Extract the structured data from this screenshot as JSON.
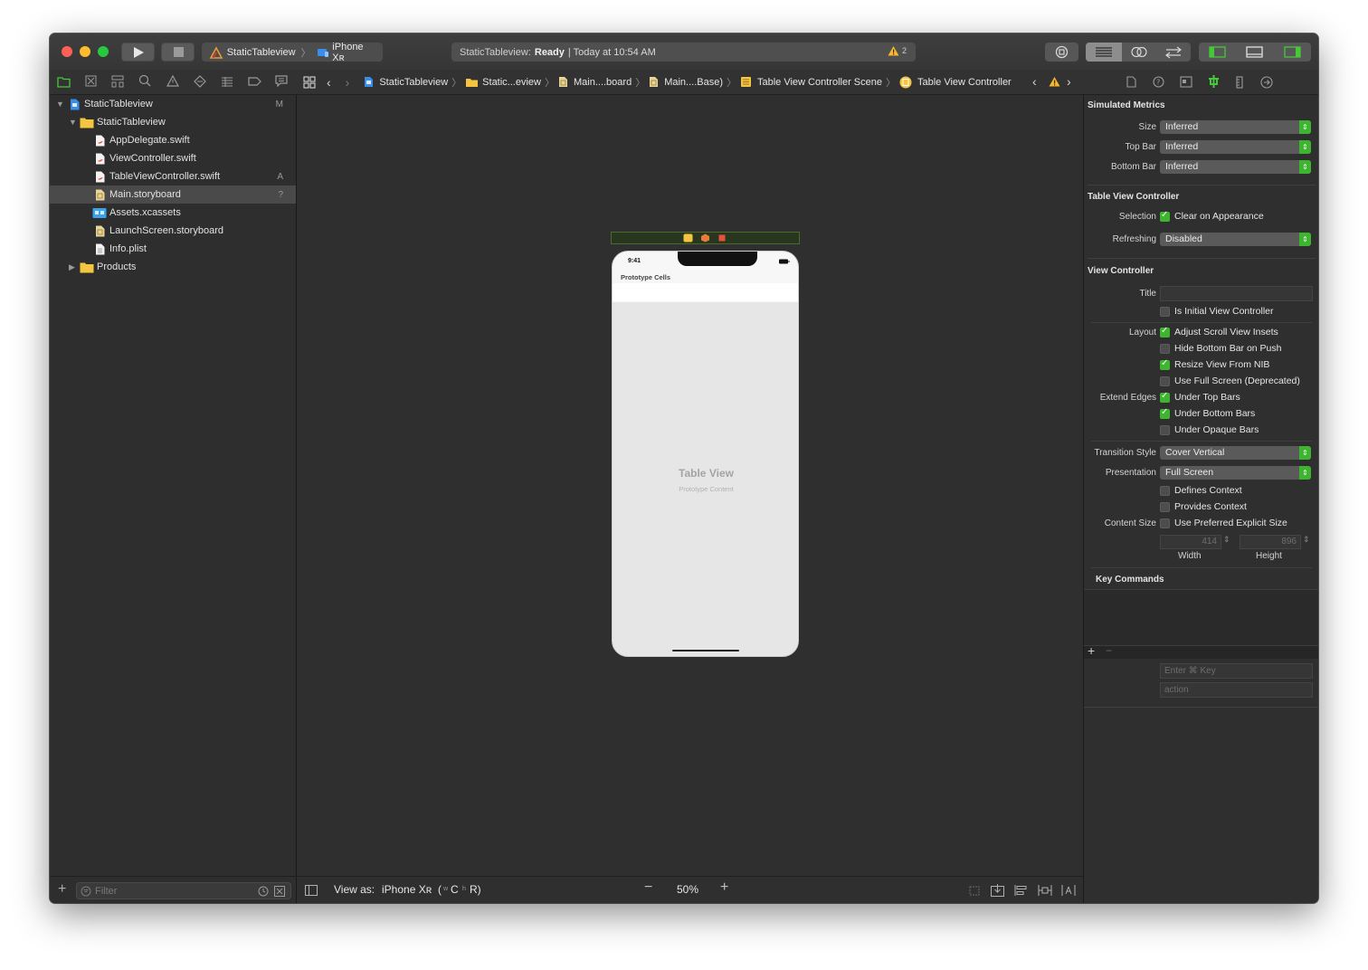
{
  "toolbar": {
    "scheme_name": "StaticTableview",
    "device_name": "iPhone Xʀ",
    "status_project": "StaticTableview:",
    "status_state": "Ready",
    "status_time": "| Today at 10:54 AM",
    "warning_count": "2"
  },
  "jumpbar": {
    "items": [
      "StaticTableview",
      "Static...eview",
      "Main....board",
      "Main....Base)",
      "Table View Controller Scene",
      "Table View Controller"
    ]
  },
  "navigator": {
    "items": [
      {
        "label": "StaticTableview",
        "badge": "M"
      },
      {
        "label": "StaticTableview",
        "badge": ""
      },
      {
        "label": "AppDelegate.swift",
        "badge": ""
      },
      {
        "label": "ViewController.swift",
        "badge": ""
      },
      {
        "label": "TableViewController.swift",
        "badge": "A"
      },
      {
        "label": "Main.storyboard",
        "badge": "?"
      },
      {
        "label": "Assets.xcassets",
        "badge": ""
      },
      {
        "label": "LaunchScreen.storyboard",
        "badge": ""
      },
      {
        "label": "Info.plist",
        "badge": ""
      },
      {
        "label": "Products",
        "badge": ""
      }
    ],
    "filter_placeholder": "Filter"
  },
  "canvas": {
    "phone_time": "9:41",
    "section_header": "Prototype Cells",
    "table_title": "Table View",
    "table_subtitle": "Prototype Content",
    "view_as_prefix": "View as:",
    "view_as_device": "iPhone Xʀ",
    "view_as_w": "w",
    "view_as_c": "C",
    "view_as_h": "h",
    "view_as_r": "R)",
    "view_as_paren": "(",
    "zoom": "50%"
  },
  "inspector": {
    "simulated_metrics": {
      "title": "Simulated Metrics",
      "size_label": "Size",
      "size_value": "Inferred",
      "topbar_label": "Top Bar",
      "topbar_value": "Inferred",
      "bottombar_label": "Bottom Bar",
      "bottombar_value": "Inferred"
    },
    "table_view_controller": {
      "title": "Table View Controller",
      "selection_label": "Selection",
      "clear_on_appearance": "Clear on Appearance",
      "refreshing_label": "Refreshing",
      "refreshing_value": "Disabled"
    },
    "view_controller": {
      "title": "View Controller",
      "title_label": "Title",
      "is_initial": "Is Initial View Controller",
      "layout_label": "Layout",
      "adjust_scroll": "Adjust Scroll View Insets",
      "hide_bottom_bar": "Hide Bottom Bar on Push",
      "resize_view": "Resize View From NIB",
      "use_full_screen": "Use Full Screen (Deprecated)",
      "extend_edges_label": "Extend Edges",
      "under_top_bars": "Under Top Bars",
      "under_bottom_bars": "Under Bottom Bars",
      "under_opaque_bars": "Under Opaque Bars",
      "transition_label": "Transition Style",
      "transition_value": "Cover Vertical",
      "presentation_label": "Presentation",
      "presentation_value": "Full Screen",
      "defines_context": "Defines Context",
      "provides_context": "Provides Context",
      "content_size_label": "Content Size",
      "use_preferred_size": "Use Preferred Explicit Size",
      "width_value": "414",
      "height_value": "896",
      "width_label": "Width",
      "height_label": "Height"
    },
    "key_commands": {
      "title": "Key Commands",
      "add": "+",
      "remove": "−",
      "key_placeholder": "Enter ⌘ Key",
      "action_placeholder": "action"
    }
  },
  "colors": {
    "accent_green": "#3db52e",
    "window_bg": "#2b2b2b"
  }
}
